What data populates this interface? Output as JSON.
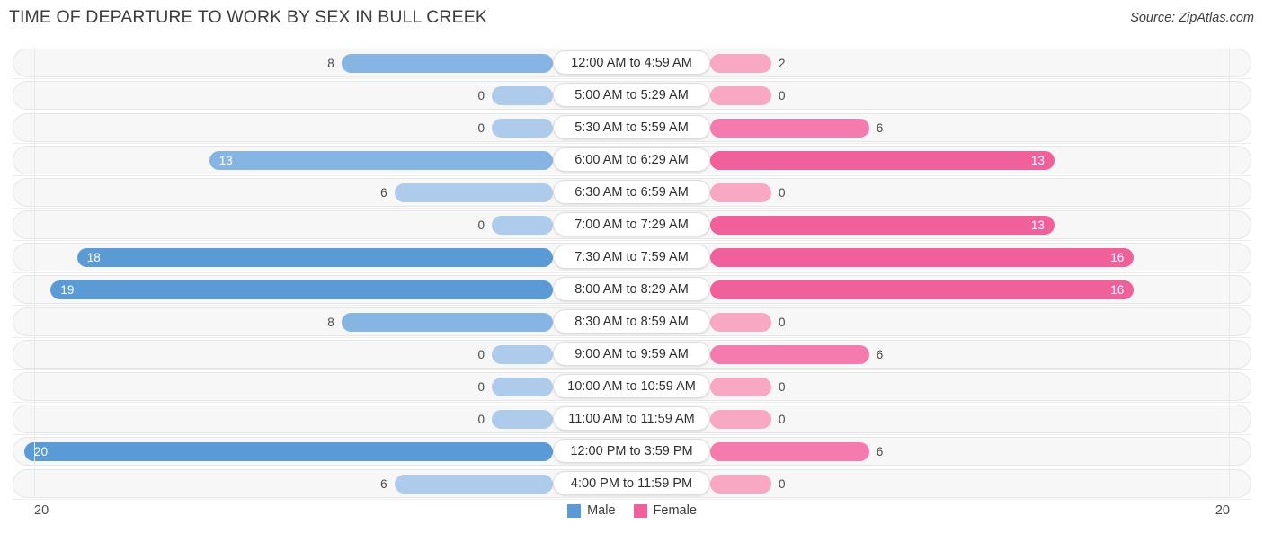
{
  "header": {
    "title": "TIME OF DEPARTURE TO WORK BY SEX IN BULL CREEK",
    "source": "Source: ZipAtlas.com"
  },
  "legend": {
    "male_label": "Male",
    "female_label": "Female",
    "male_color": "#5b9bd5",
    "female_color": "#f0609b"
  },
  "axis": {
    "left_label": "20",
    "right_label": "20"
  },
  "colors": {
    "male_strong": "#5b9bd5",
    "male_mid": "#86b5e3",
    "male_light": "#aecbeb",
    "female_strong": "#f0609b",
    "female_mid": "#f57aae",
    "female_light": "#f9a8c4",
    "track_bg": "#f7f7f7",
    "track_border": "#e6e6e6"
  },
  "chart_data": {
    "type": "bar",
    "title": "TIME OF DEPARTURE TO WORK BY SEX IN BULL CREEK",
    "subtitle": "",
    "xlabel": "",
    "ylabel": "",
    "orientation": "horizontal-diverging",
    "xlim": [
      20,
      0,
      20
    ],
    "grid": false,
    "legend_position": "bottom-center",
    "categories": [
      "12:00 AM to 4:59 AM",
      "5:00 AM to 5:29 AM",
      "5:30 AM to 5:59 AM",
      "6:00 AM to 6:29 AM",
      "6:30 AM to 6:59 AM",
      "7:00 AM to 7:29 AM",
      "7:30 AM to 7:59 AM",
      "8:00 AM to 8:29 AM",
      "8:30 AM to 8:59 AM",
      "9:00 AM to 9:59 AM",
      "10:00 AM to 10:59 AM",
      "11:00 AM to 11:59 AM",
      "12:00 PM to 3:59 PM",
      "4:00 PM to 11:59 PM"
    ],
    "series": [
      {
        "name": "Male",
        "values": [
          8,
          0,
          0,
          13,
          6,
          0,
          18,
          19,
          8,
          0,
          0,
          0,
          20,
          6
        ]
      },
      {
        "name": "Female",
        "values": [
          2,
          0,
          6,
          13,
          0,
          13,
          16,
          16,
          0,
          6,
          0,
          0,
          6,
          0
        ]
      }
    ]
  },
  "rows": [
    {
      "label": "12:00 AM to 4:59 AM",
      "male": "8",
      "female": "2"
    },
    {
      "label": "5:00 AM to 5:29 AM",
      "male": "0",
      "female": "0"
    },
    {
      "label": "5:30 AM to 5:59 AM",
      "male": "0",
      "female": "6"
    },
    {
      "label": "6:00 AM to 6:29 AM",
      "male": "13",
      "female": "13"
    },
    {
      "label": "6:30 AM to 6:59 AM",
      "male": "6",
      "female": "0"
    },
    {
      "label": "7:00 AM to 7:29 AM",
      "male": "0",
      "female": "13"
    },
    {
      "label": "7:30 AM to 7:59 AM",
      "male": "18",
      "female": "16"
    },
    {
      "label": "8:00 AM to 8:29 AM",
      "male": "19",
      "female": "16"
    },
    {
      "label": "8:30 AM to 8:59 AM",
      "male": "8",
      "female": "0"
    },
    {
      "label": "9:00 AM to 9:59 AM",
      "male": "0",
      "female": "6"
    },
    {
      "label": "10:00 AM to 10:59 AM",
      "male": "0",
      "female": "0"
    },
    {
      "label": "11:00 AM to 11:59 AM",
      "male": "0",
      "female": "0"
    },
    {
      "label": "12:00 PM to 3:59 PM",
      "male": "20",
      "female": "6"
    },
    {
      "label": "4:00 PM to 11:59 PM",
      "male": "6",
      "female": "0"
    }
  ]
}
